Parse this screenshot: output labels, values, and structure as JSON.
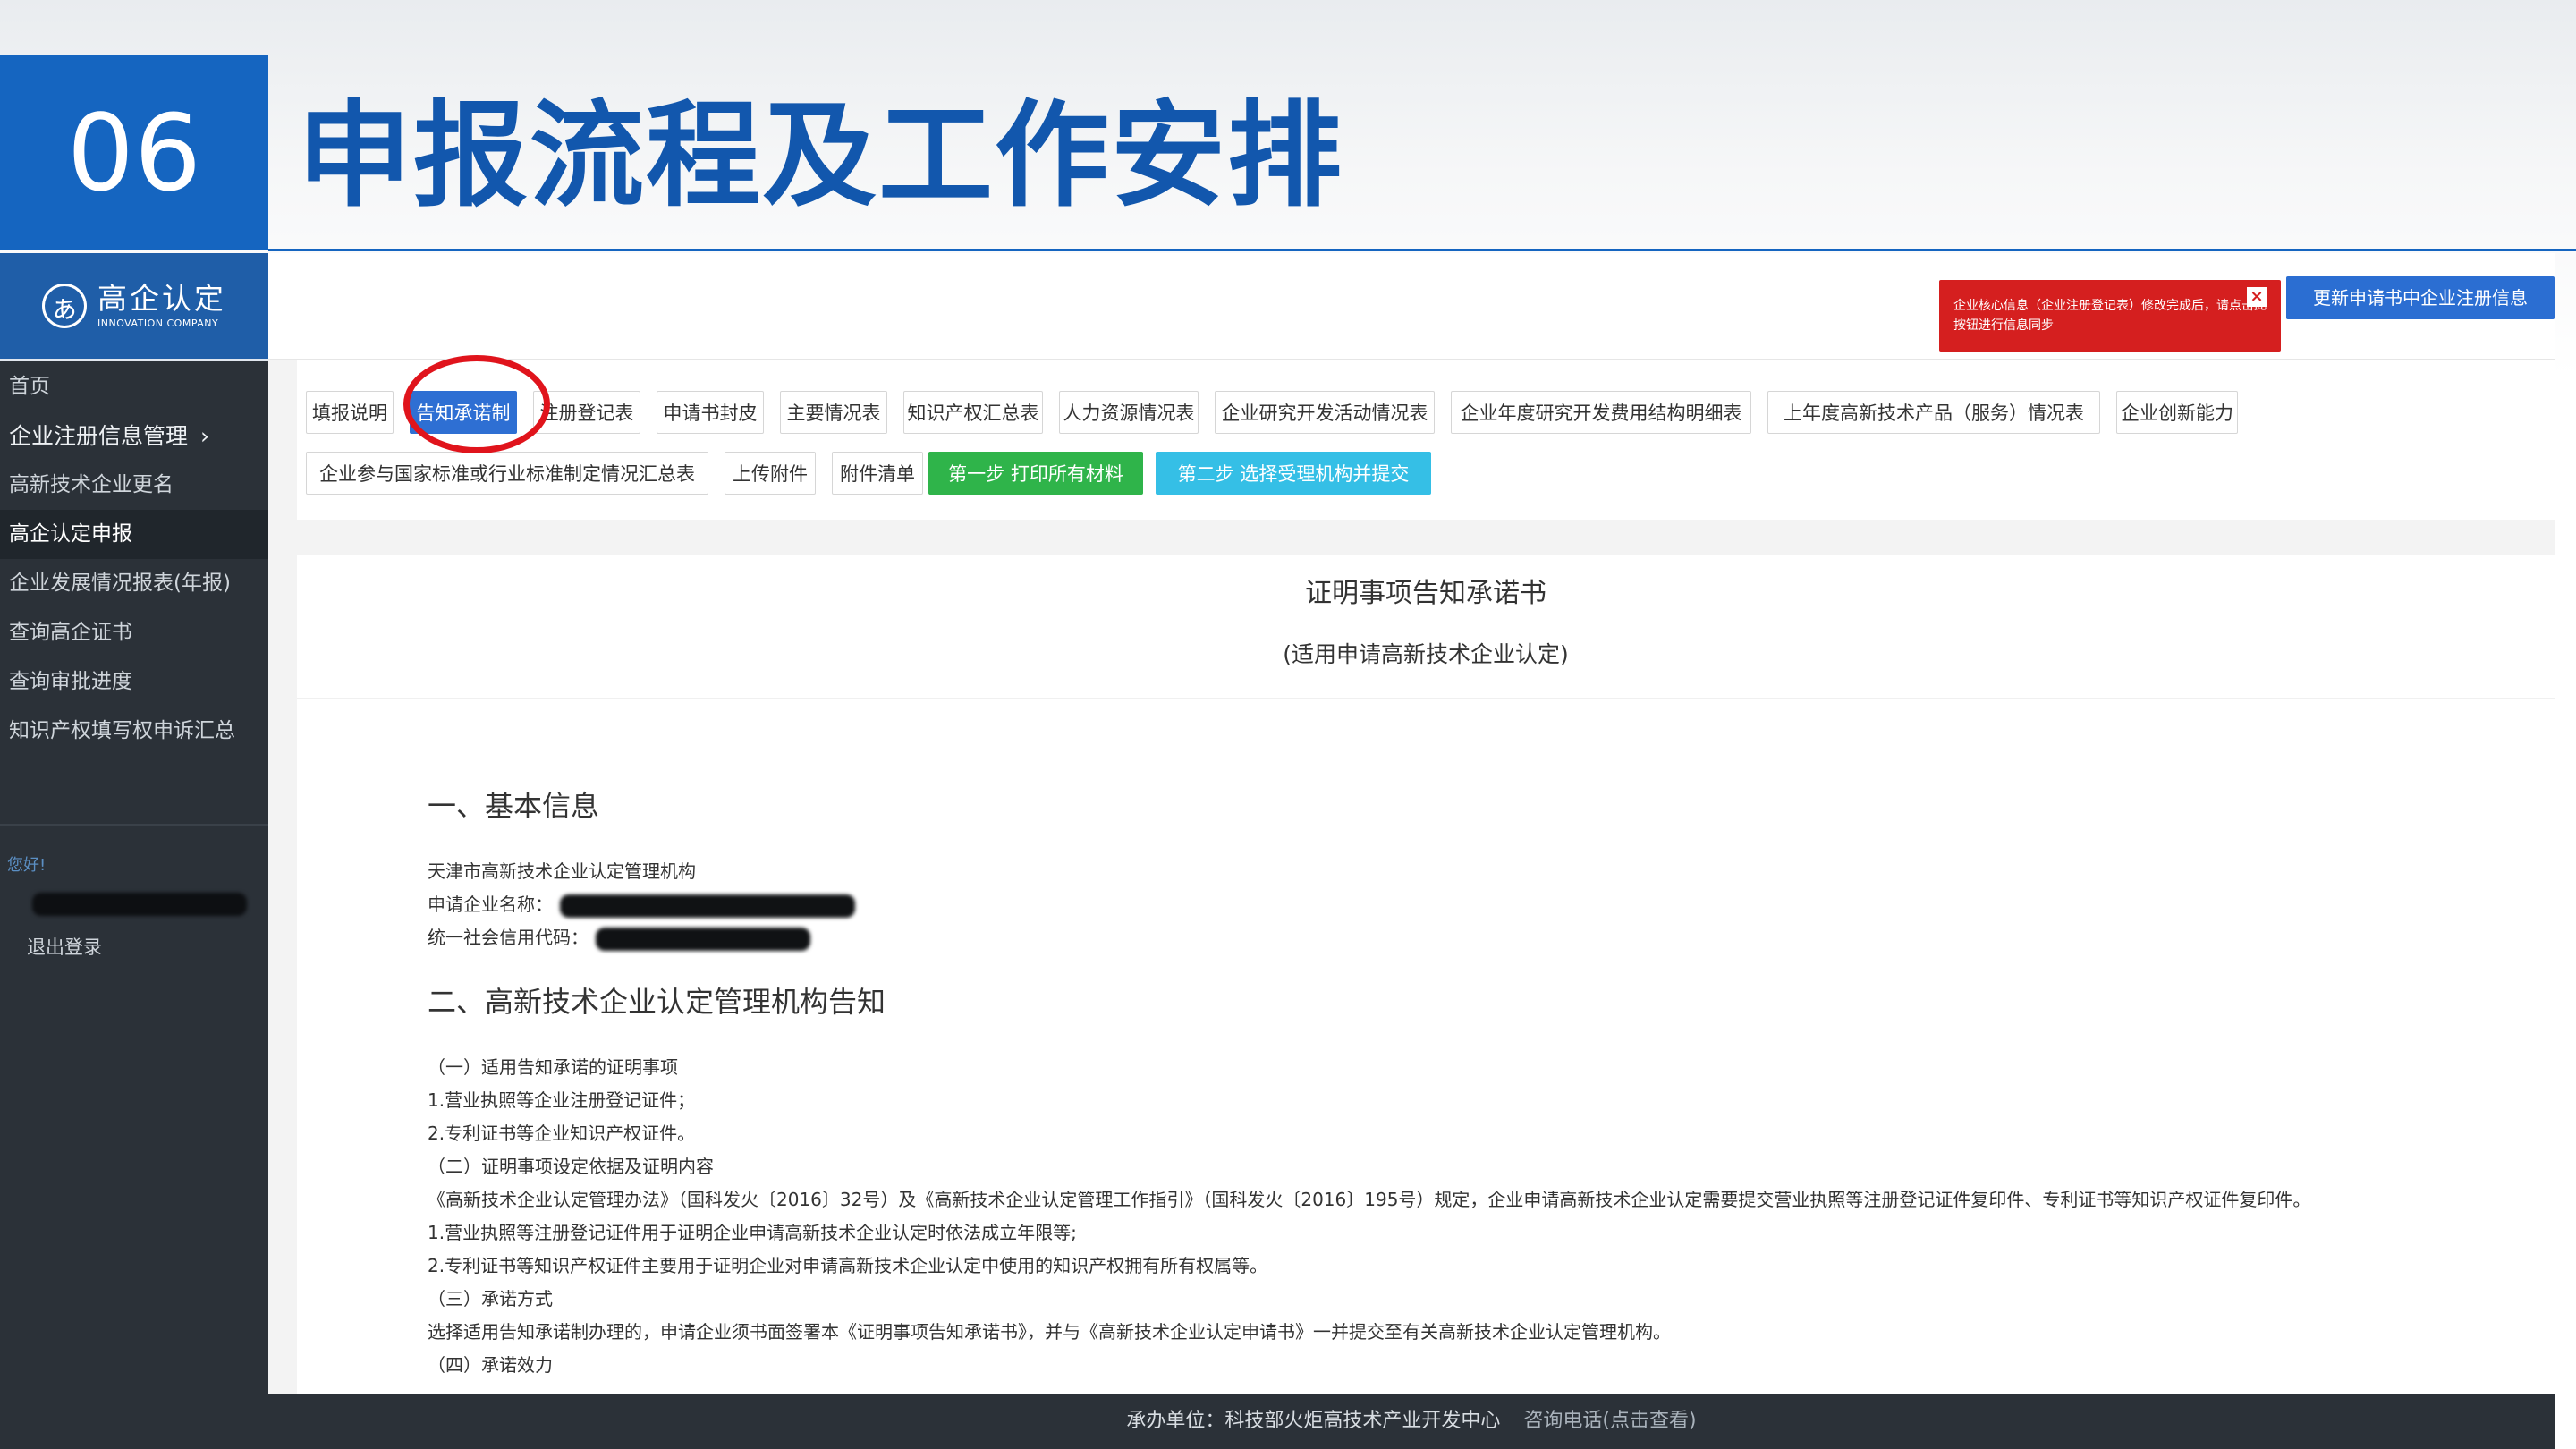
{
  "slide": {
    "number": "06",
    "title": "申报流程及工作安排"
  },
  "app": {
    "logo": {
      "name": "高企认定",
      "tagline": "INNOVATION COMPANY"
    },
    "sidebar": {
      "items": [
        {
          "label": "首页"
        },
        {
          "label": "企业注册信息管理",
          "chevron": "›"
        },
        {
          "label": "高新技术企业更名"
        },
        {
          "label": "高企认定申报"
        },
        {
          "label": "企业发展情况报表(年报)"
        },
        {
          "label": "查询高企证书"
        },
        {
          "label": "查询审批进度"
        },
        {
          "label": "知识产权填写权申诉汇总"
        }
      ],
      "greeting": "您好!",
      "logout": "退出登录"
    },
    "notice": {
      "text": "企业核心信息（企业注册登记表）修改完成后，请点击此按钮进行信息同步",
      "close": "×"
    },
    "update_button": "更新申请书中企业注册信息",
    "tabs": {
      "row1": [
        "填报说明",
        "告知承诺制",
        "注册登记表",
        "申请书封皮",
        "主要情况表",
        "知识产权汇总表",
        "人力资源情况表",
        "企业研究开发活动情况表",
        "企业年度研究开发费用结构明细表",
        "上年度高新技术产品（服务）情况表",
        "企业创新能力"
      ],
      "row2": [
        "企业参与国家标准或行业标准制定情况汇总表",
        "上传附件",
        "附件清单"
      ],
      "step1": "第一步 打印所有材料",
      "step2": "第二步 选择受理机构并提交",
      "active": "告知承诺制"
    },
    "document": {
      "title": "证明事项告知承诺书",
      "subtitle": "(适用申请高新技术企业认定)",
      "section1": {
        "heading": "一、基本信息",
        "org": "天津市高新技术企业认定管理机构",
        "company_label": "申请企业名称：",
        "credit_label": "统一社会信用代码："
      },
      "section2": {
        "heading": "二、高新技术企业认定管理机构告知",
        "lines": [
          "（一）适用告知承诺的证明事项",
          "1.营业执照等企业注册登记证件；",
          "2.专利证书等企业知识产权证件。",
          "（二）证明事项设定依据及证明内容",
          "《高新技术企业认定管理办法》（国科发火〔2016〕32号）及《高新技术企业认定管理工作指引》（国科发火〔2016〕195号）规定，企业申请高新技术企业认定需要提交营业执照等注册登记证件复印件、专利证书等知识产权证件复印件。",
          "1.营业执照等注册登记证件用于证明企业申请高新技术企业认定时依法成立年限等;",
          "2.专利证书等知识产权证件主要用于证明企业对申请高新技术企业认定中使用的知识产权拥有所有权属等。",
          "（三）承诺方式",
          "选择适用告知承诺制办理的，申请企业须书面签署本《证明事项告知承诺书》，并与《高新技术企业认定申请书》一并提交至有关高新技术企业认定管理机构。",
          "（四）承诺效力"
        ]
      }
    },
    "footer": {
      "org": "承办单位：科技部火炬高技术产业开发中心",
      "tel": "咨询电话(点击查看)"
    }
  },
  "colors": {
    "brand_blue": "#1565c0",
    "title_blue": "#1257ad",
    "tab_active": "#2e6fd3",
    "step1_green": "#2fb44a",
    "step2_cyan": "#35bfe6",
    "notice_red": "#d51f1f",
    "highlight_ring": "#e0141c",
    "sidebar_bg": "#2b3138"
  }
}
